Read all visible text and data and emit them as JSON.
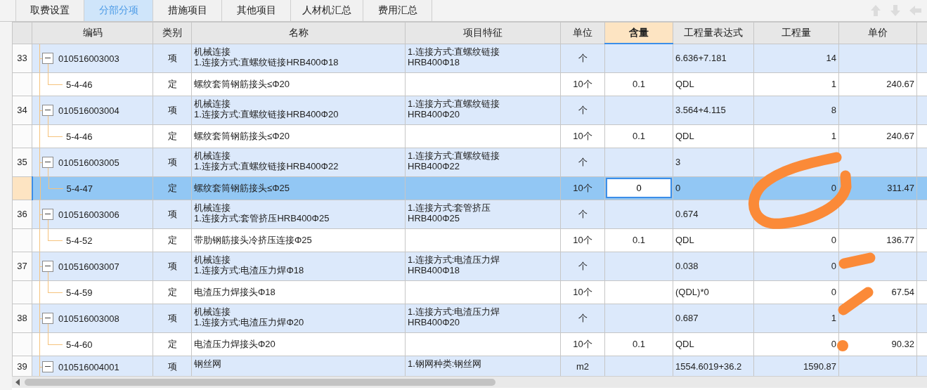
{
  "tabs": [
    {
      "label": "取费设置",
      "selected": false
    },
    {
      "label": "分部分项",
      "selected": true
    },
    {
      "label": "措施项目",
      "selected": false
    },
    {
      "label": "其他项目",
      "selected": false
    },
    {
      "label": "人材机汇总",
      "selected": false
    },
    {
      "label": "费用汇总",
      "selected": false
    }
  ],
  "columns": [
    {
      "label": "编码",
      "selected": false
    },
    {
      "label": "类别",
      "selected": false
    },
    {
      "label": "名称",
      "selected": false
    },
    {
      "label": "项目特征",
      "selected": false
    },
    {
      "label": "单位",
      "selected": false
    },
    {
      "label": "含量",
      "selected": true
    },
    {
      "label": "工程量表达式",
      "selected": false
    },
    {
      "label": "工程量",
      "selected": false
    },
    {
      "label": "单价",
      "selected": false
    }
  ],
  "rows": [
    {
      "number": "33",
      "code": "010516003003",
      "type": "项",
      "name": [
        "机械连接",
        "1.连接方式:直螺纹链接HRB400Φ18"
      ],
      "features": [
        "1.连接方式:直螺纹链接",
        "HRB400Φ18"
      ],
      "unit": "个",
      "expression": "6.636+7.181",
      "quantity": "14",
      "selected": false,
      "expanded": true,
      "children": [
        {
          "code": "5-4-46",
          "type": "定",
          "name": [
            "螺纹套筒钢筋接头≤Φ20"
          ],
          "unit": "10个",
          "content": "0.1",
          "expression": "QDL",
          "quantity": "1",
          "price": "240.67",
          "selected": false,
          "editing": false
        }
      ]
    },
    {
      "number": "34",
      "code": "010516003004",
      "type": "项",
      "name": [
        "机械连接",
        "1.连接方式:直螺纹链接HRB400Φ20"
      ],
      "features": [
        "1.连接方式:直螺纹链接",
        "HRB400Φ20"
      ],
      "unit": "个",
      "expression": "3.564+4.115",
      "quantity": "8",
      "selected": false,
      "expanded": true,
      "children": [
        {
          "code": "5-4-46",
          "type": "定",
          "name": [
            "螺纹套筒钢筋接头≤Φ20"
          ],
          "unit": "10个",
          "content": "0.1",
          "expression": "QDL",
          "quantity": "1",
          "price": "240.67",
          "selected": false,
          "editing": false
        }
      ]
    },
    {
      "number": "35",
      "code": "010516003005",
      "type": "项",
      "name": [
        "机械连接",
        "1.连接方式:直螺纹链接HRB400Φ22"
      ],
      "features": [
        "1.连接方式:直螺纹链接",
        "HRB400Φ22"
      ],
      "unit": "个",
      "expression": "3",
      "selected": false,
      "expanded": true,
      "children": [
        {
          "code": "5-4-47",
          "type": "定",
          "name": [
            "螺纹套筒钢筋接头≤Φ25"
          ],
          "unit": "10个",
          "content": "0",
          "expression": "0",
          "quantity": "0",
          "price": "311.47",
          "selected": true,
          "editing": true
        }
      ]
    },
    {
      "number": "36",
      "code": "010516003006",
      "type": "项",
      "name": [
        "机械连接",
        "1.连接方式:套管挤压HRB400Φ25"
      ],
      "features": [
        "1.连接方式:套管挤压",
        "HRB400Φ25"
      ],
      "unit": "个",
      "expression": "0.674",
      "selected": false,
      "expanded": true,
      "children": [
        {
          "code": "5-4-52",
          "type": "定",
          "name": [
            "带肋钢筋接头冷挤压连接Φ25"
          ],
          "unit": "10个",
          "content": "0.1",
          "expression": "QDL",
          "quantity": "0",
          "price": "136.77",
          "selected": false,
          "editing": false
        }
      ]
    },
    {
      "number": "37",
      "code": "010516003007",
      "type": "项",
      "name": [
        "机械连接",
        "1.连接方式:电渣压力焊Φ18"
      ],
      "features": [
        "1.连接方式:电渣压力焊",
        "HRB400Φ18"
      ],
      "unit": "个",
      "expression": "0.038",
      "quantity": "0",
      "selected": false,
      "expanded": true,
      "children": [
        {
          "code": "5-4-59",
          "type": "定",
          "name": [
            "电渣压力焊接头Φ18"
          ],
          "unit": "10个",
          "expression": "(QDL)*0",
          "quantity": "0",
          "price": "67.54",
          "selected": false,
          "editing": false
        }
      ]
    },
    {
      "number": "38",
      "code": "010516003008",
      "type": "项",
      "name": [
        "机械连接",
        "1.连接方式:电渣压力焊Φ20"
      ],
      "features": [
        "1.连接方式:电渣压力焊",
        "HRB400Φ20"
      ],
      "unit": "个",
      "expression": "0.687",
      "quantity": "1",
      "selected": false,
      "expanded": true,
      "children": [
        {
          "code": "5-4-60",
          "type": "定",
          "name": [
            "电渣压力焊接头Φ20"
          ],
          "unit": "10个",
          "content": "0.1",
          "expression": "QDL",
          "quantity": "0",
          "price": "90.32",
          "selected": false,
          "editing": false
        }
      ]
    },
    {
      "number": "39",
      "code": "010516004001",
      "type": "项",
      "name": [
        "钢丝网"
      ],
      "features": [
        "1.钢网种类:钢丝网"
      ],
      "unit": "m2",
      "expression": "1554.6019+36.2",
      "quantity": "1590.87",
      "selected": false,
      "expanded": true,
      "children": []
    }
  ]
}
